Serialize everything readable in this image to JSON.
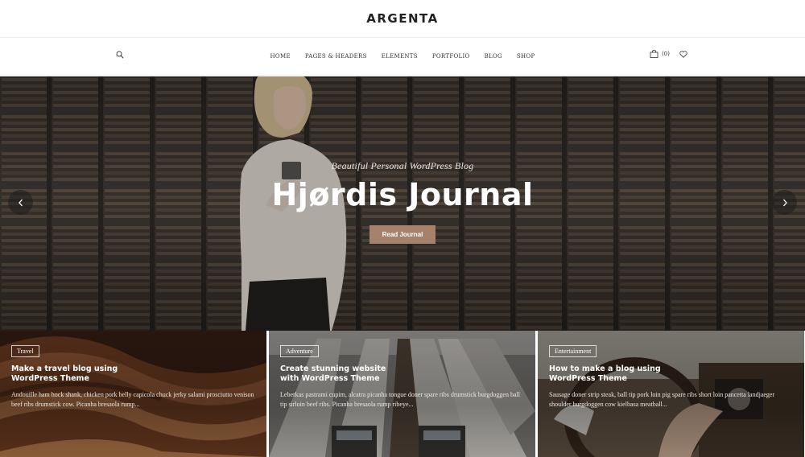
{
  "site": {
    "logo": "ARGENTA"
  },
  "nav": {
    "items": [
      "HOME",
      "PAGES & HEADERS",
      "ELEMENTS",
      "PORTFOLIO",
      "BLOG",
      "SHOP"
    ],
    "cart_count": "(0)",
    "icons": {
      "search": "search-icon",
      "cart": "shopping-bag-icon",
      "wishlist": "heart-icon"
    }
  },
  "hero": {
    "subtitle": "Beautiful Personal WordPress Blog",
    "title": "Hjørdis Journal",
    "button": "Read Journal",
    "prev_icon": "chevron-left-icon",
    "next_icon": "chevron-right-icon"
  },
  "cards": [
    {
      "tag": "Travel",
      "title": "Make a travel blog using WordPress Theme",
      "text": "Andouille ham hock shank, chicken pork belly capicola chuck jerky salami prosciutto venison beef ribs drumstick cow. Picanha bresaola rump..."
    },
    {
      "tag": "Adventure",
      "title": "Create stunning website with WordPress Theme",
      "text": "Leberkas pastrami cupim, alcatra picanha tongue doner spare ribs drumstick burgdoggen ball tip sirloin beef ribs. Picanha bresaola rump ribeye..."
    },
    {
      "tag": "Entertainment",
      "title": "How to make a blog using WordPress Theme",
      "text": "Sausage doner strip steak, ball tip pork loin pig spare ribs short loin pancetta landjaeger shoulder burgdoggen cow kielbasa meatball..."
    }
  ],
  "colors": {
    "accent": "#a6826c",
    "text": "#222222"
  }
}
